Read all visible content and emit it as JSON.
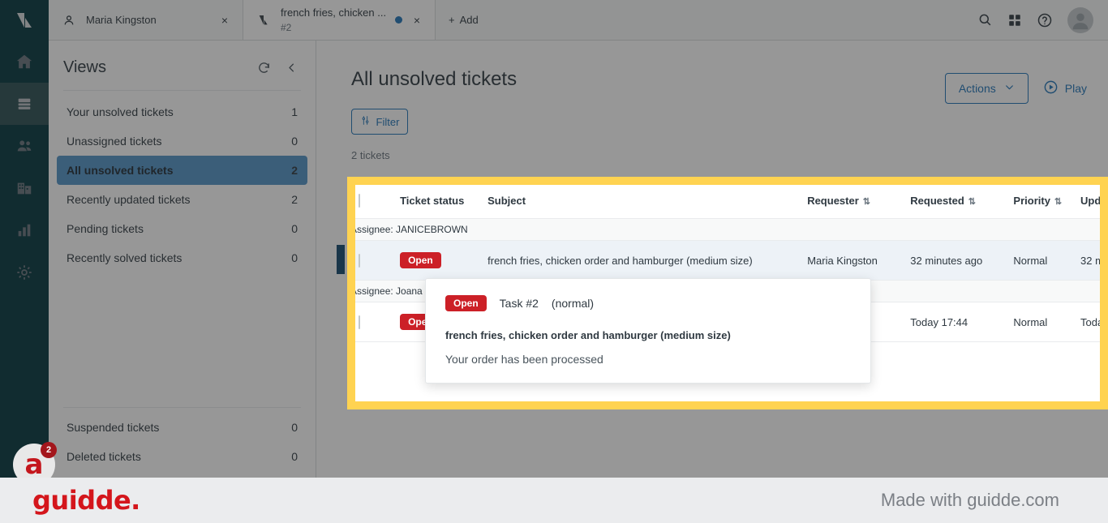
{
  "rail": {
    "logo_icon": "zendesk-logo-icon",
    "items": [
      {
        "name": "home",
        "icon": "home-icon",
        "active": false
      },
      {
        "name": "tickets",
        "icon": "tickets-icon",
        "active": true
      },
      {
        "name": "customers",
        "icon": "people-icon",
        "active": false
      },
      {
        "name": "organizations",
        "icon": "building-icon",
        "active": false
      },
      {
        "name": "reporting",
        "icon": "bar-chart-icon",
        "active": false
      },
      {
        "name": "admin",
        "icon": "gear-icon",
        "active": false
      }
    ]
  },
  "topbar": {
    "tabs": [
      {
        "icon": "user-icon",
        "title": "Maria Kingston",
        "subtitle": "",
        "dot": false,
        "close": "×"
      },
      {
        "icon": "tickets-icon",
        "title": "french fries, chicken ...",
        "subtitle": "#2",
        "dot": true,
        "close": "×"
      }
    ],
    "add_label": "Add",
    "add_plus": "+",
    "icons": [
      "search-icon",
      "apps-grid-icon",
      "help-icon",
      "avatar"
    ]
  },
  "sidebar": {
    "title": "Views",
    "refresh_icon": "refresh-icon",
    "collapse_icon": "chevron-left-icon",
    "items": [
      {
        "label": "Your unsolved tickets",
        "count": "1",
        "active": false
      },
      {
        "label": "Unassigned tickets",
        "count": "0",
        "active": false
      },
      {
        "label": "All unsolved tickets",
        "count": "2",
        "active": true
      },
      {
        "label": "Recently updated tickets",
        "count": "2",
        "active": false
      },
      {
        "label": "Pending tickets",
        "count": "0",
        "active": false
      },
      {
        "label": "Recently solved tickets",
        "count": "0",
        "active": false
      }
    ],
    "bottom_items": [
      {
        "label": "Suspended tickets",
        "count": "0"
      },
      {
        "label": "Deleted tickets",
        "count": "0"
      }
    ]
  },
  "main": {
    "page_title": "All unsolved tickets",
    "actions_label": "Actions",
    "actions_caret": "chevron-down-icon",
    "play_label": "Play",
    "play_icon": "play-circle-icon",
    "filter_label": "Filter",
    "filter_icon": "filter-sliders-icon",
    "ticket_count": "2 tickets"
  },
  "table": {
    "columns": [
      {
        "label": "",
        "sortable": false
      },
      {
        "label": "Ticket status",
        "sortable": false
      },
      {
        "label": "Subject",
        "sortable": false
      },
      {
        "label": "Requester",
        "sortable": true
      },
      {
        "label": "Requested",
        "sortable": true
      },
      {
        "label": "Priority",
        "sortable": true
      },
      {
        "label": "Upd",
        "sortable": true
      }
    ],
    "sort_glyph": "⇅",
    "groups": [
      {
        "header": "Assignee: JANICEBROWN",
        "rows": [
          {
            "status": "Open",
            "subject": "french fries, chicken order and hamburger (medium size)",
            "requester": "Maria Kingston",
            "requested": "32 minutes ago",
            "priority": "Normal",
            "updated": "32 m"
          }
        ]
      },
      {
        "header": "Assignee: Joana ol",
        "rows": [
          {
            "status": "Open",
            "subject": "french fries, chicken order and hamburger",
            "requester": "er",
            "requested": "Today 17:44",
            "priority": "Normal",
            "updated": "Toda"
          }
        ]
      }
    ]
  },
  "tooltip": {
    "status_badge": "Open",
    "task": "Task #2",
    "priority": "(normal)",
    "subject": "french fries, chicken order and hamburger (medium size)",
    "description": "Your order has been processed"
  },
  "guidde": {
    "badge_letter": "a",
    "badge_count": "2",
    "footer_logo": "guidde.",
    "footer_made": "Made with guidde.com"
  },
  "colors": {
    "rail_bg": "#03363d",
    "accent_blue": "#1f73b7",
    "highlight_yellow": "#ffd351",
    "status_red": "#cc2027",
    "selected_row": "#edf2f7",
    "active_view": "#5293c7",
    "guidde_red": "#d4161c"
  }
}
